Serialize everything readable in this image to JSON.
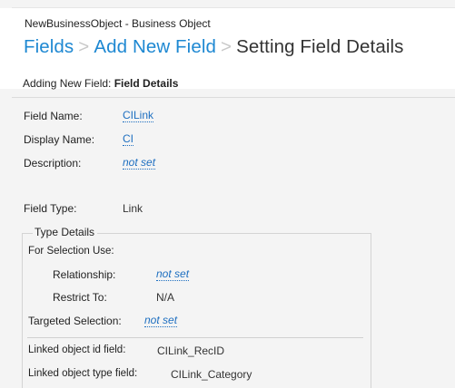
{
  "header": {
    "object_title": "NewBusinessObject - Business Object",
    "breadcrumb": {
      "fields": "Fields",
      "add_new_field": "Add New Field",
      "separator": ">",
      "current": "Setting Field Details"
    },
    "adding_prefix": "Adding New Field: ",
    "adding_bold": "Field Details"
  },
  "details": {
    "field_name_label": "Field Name:",
    "field_name_value": "CILink",
    "display_name_label": "Display Name:",
    "display_name_value": "CI",
    "description_label": "Description:",
    "description_value": "not set",
    "field_type_label": "Field Type:",
    "field_type_value": "Link"
  },
  "type_details": {
    "legend": "Type Details",
    "for_selection_use": "For Selection Use:",
    "relationship_label": "Relationship:",
    "relationship_value": "not set",
    "restrict_to_label": "Restrict To:",
    "restrict_to_value": "N/A",
    "targeted_selection_label": "Targeted Selection:",
    "targeted_selection_value": "not set",
    "linked_id_label": "Linked object id field:",
    "linked_id_value": "CILink_RecID",
    "linked_type_label": "Linked object type field:",
    "linked_type_value": "CILink_Category"
  },
  "colors": {
    "link": "#1e88d2",
    "value_link": "#1e6fc0",
    "background": "#f4f4f4",
    "header_bg": "#ffffff"
  }
}
